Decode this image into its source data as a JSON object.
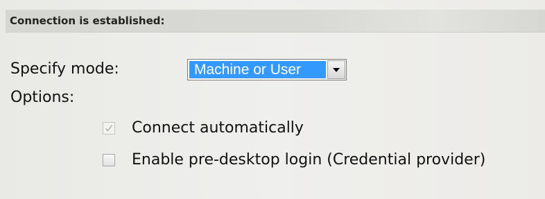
{
  "section": {
    "title": "Connection is established:"
  },
  "mode": {
    "label": "Specify mode:",
    "selected": "Machine or User",
    "arrow_icon": "dropdown-arrow-icon"
  },
  "options": {
    "label": "Options:",
    "items": [
      {
        "label": "Connect automatically",
        "checked": true,
        "disabled": true
      },
      {
        "label": "Enable pre-desktop login (Credential provider)",
        "checked": false,
        "disabled": false
      }
    ]
  },
  "colors": {
    "background": "#eeeeec",
    "header_background": "#d7d7d3",
    "selection": "#3399ff",
    "disabled_check": "#b5b5b5"
  }
}
